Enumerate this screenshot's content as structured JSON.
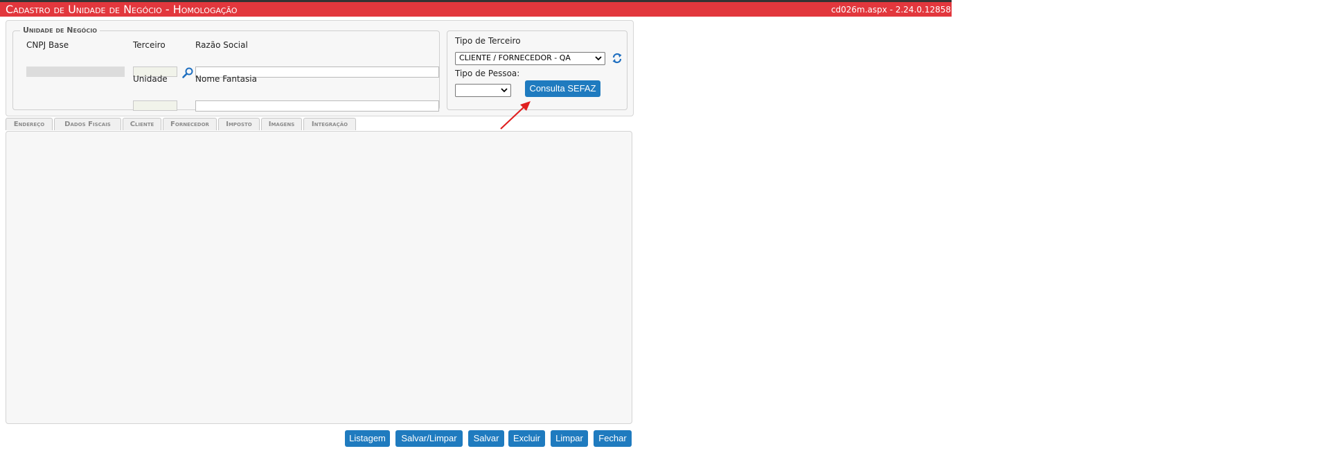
{
  "header": {
    "title": "Cadastro de Unidade de Negócio  - Homologação",
    "version": "cd026m.aspx - 2.24.0.12858"
  },
  "unidade_negocio": {
    "legend": "Unidade de Negócio",
    "cnpj_base_label": "CNPJ Base",
    "terceiro_label": "Terceiro",
    "razao_social_label": "Razão Social",
    "unidade_label": "Unidade",
    "nome_fantasia_label": "Nome Fantasia",
    "cnpj_base_value": "",
    "terceiro_value": "",
    "razao_social_value": "",
    "unidade_value": "",
    "nome_fantasia_value": ""
  },
  "tipo_terceiro": {
    "label": "Tipo de Terceiro",
    "selected": "CLIENTE / FORNECEDOR - QA",
    "tipo_pessoa_label": "Tipo de Pessoa:",
    "tipo_pessoa_selected": "",
    "consulta_button": "Consulta SEFAZ"
  },
  "tabs": [
    {
      "label": "Endereço"
    },
    {
      "label": "Dados Fiscais"
    },
    {
      "label": "Cliente"
    },
    {
      "label": "Fornecedor"
    },
    {
      "label": "Imposto"
    },
    {
      "label": "Imagens"
    },
    {
      "label": "Integração"
    }
  ],
  "actions": {
    "listagem": "Listagem",
    "salvar_limpar": "Salvar/Limpar",
    "salvar": "Salvar",
    "excluir": "Excluir",
    "limpar": "Limpar",
    "fechar": "Fechar"
  },
  "colors": {
    "title_bar": "#e2373d",
    "button": "#1f7bbf",
    "annotation_arrow": "#e02020"
  }
}
